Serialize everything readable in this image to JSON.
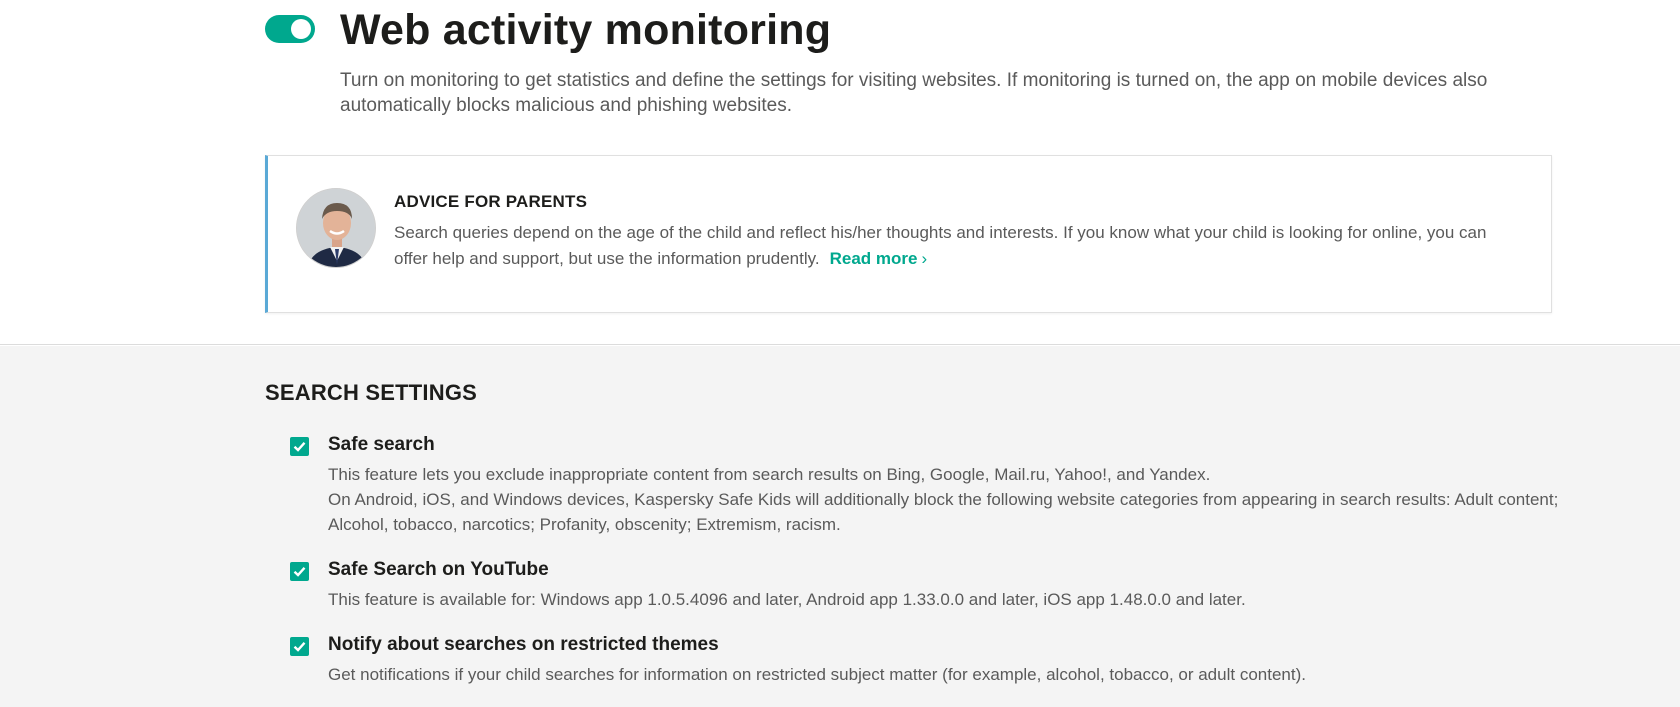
{
  "monitoring": {
    "enabled": true,
    "title": "Web activity monitoring",
    "description": "Turn on monitoring to get statistics and define the settings for visiting websites. If monitoring is turned on, the app on mobile devices also automatically blocks malicious and phishing websites."
  },
  "advice": {
    "heading": "ADVICE FOR PARENTS",
    "text": "Search queries depend on the age of the child and reflect his/her thoughts and interests. If you know what your child is looking for online, you can offer help and support, but use the information prudently.",
    "link_label": "Read more",
    "link_chevron": "›"
  },
  "search_settings": {
    "heading": "SEARCH SETTINGS",
    "options": [
      {
        "label": "Safe search",
        "checked": true,
        "description_lines": [
          "This feature lets you exclude inappropriate content from search results on Bing, Google, Mail.ru, Yahoo!, and Yandex.",
          "On Android, iOS, and Windows devices, Kaspersky Safe Kids will additionally block the following website categories from appearing in search results: Adult content; Alcohol, tobacco, narcotics; Profanity, obscenity; Extremism, racism."
        ]
      },
      {
        "label": "Safe Search on YouTube",
        "checked": true,
        "description_lines": [
          "This feature is available for: Windows app 1.0.5.4096 and later, Android app 1.33.0.0 and later, iOS app 1.48.0.0 and later."
        ]
      },
      {
        "label": "Notify about searches on restricted themes",
        "checked": true,
        "description_lines": [
          "Get notifications if your child searches for information on restricted subject matter (for example, alcohol, tobacco, or adult content)."
        ]
      }
    ]
  },
  "colors": {
    "accent": "#00a88e",
    "advice_border": "#5aa9d6",
    "settings_background": "#f4f4f4"
  }
}
